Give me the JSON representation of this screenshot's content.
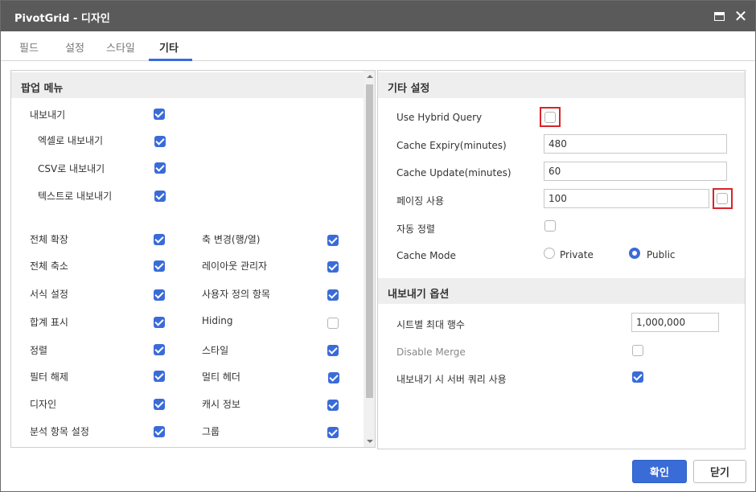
{
  "window": {
    "title": "PivotGrid - 디자인"
  },
  "tabs": [
    {
      "label": "필드"
    },
    {
      "label": "설정"
    },
    {
      "label": "스타일"
    },
    {
      "label": "기타",
      "active": true
    }
  ],
  "popup_menu": {
    "header": "팝업 메뉴",
    "export_items": [
      {
        "label": "내보내기",
        "checked": true
      },
      {
        "label": "엑셀로 내보내기",
        "checked": true
      },
      {
        "label": "CSV로 내보내기",
        "checked": true
      },
      {
        "label": "텍스트로 내보내기",
        "checked": true
      }
    ],
    "left_items": [
      {
        "label": "전체 확장",
        "checked": true
      },
      {
        "label": "전체 축소",
        "checked": true
      },
      {
        "label": "서식 설정",
        "checked": true
      },
      {
        "label": "합계 표시",
        "checked": true
      },
      {
        "label": "정렬",
        "checked": true
      },
      {
        "label": "필터 해제",
        "checked": true
      },
      {
        "label": "디자인",
        "checked": true
      },
      {
        "label": "분석 항목 설정",
        "checked": true
      }
    ],
    "right_items": [
      {
        "label": "축 변경(행/열)",
        "checked": true
      },
      {
        "label": "레이아웃 관리자",
        "checked": true
      },
      {
        "label": "사용자 정의 항목",
        "checked": true
      },
      {
        "label": "Hiding",
        "checked": false
      },
      {
        "label": "스타일",
        "checked": true
      },
      {
        "label": "멀티 헤더",
        "checked": true
      },
      {
        "label": "캐시 정보",
        "checked": true
      },
      {
        "label": "그룹",
        "checked": true
      }
    ]
  },
  "misc_settings": {
    "header": "기타 설정",
    "use_hybrid_query": {
      "label": "Use Hybrid Query",
      "checked": false
    },
    "cache_expiry": {
      "label": "Cache Expiry(minutes)",
      "value": "480"
    },
    "cache_update": {
      "label": "Cache Update(minutes)",
      "value": "60"
    },
    "paging": {
      "label": "페이징 사용",
      "value": "100",
      "checked": false
    },
    "auto_sort": {
      "label": "자동 정렬",
      "checked": false
    },
    "cache_mode": {
      "label": "Cache Mode",
      "options": [
        "Private",
        "Public"
      ],
      "selected": "Public"
    }
  },
  "export_options": {
    "header": "내보내기 옵션",
    "max_rows_per_sheet": {
      "label": "시트별 최대 행수",
      "value": "1,000,000"
    },
    "disable_merge": {
      "label": "Disable Merge",
      "checked": false
    },
    "server_query_on_export": {
      "label": "내보내기 시 서버 쿼리 사용",
      "checked": true
    }
  },
  "footer": {
    "ok_label": "확인",
    "close_label": "닫기"
  },
  "colors": {
    "accent": "#3a6cd8",
    "titlebar": "#5a5a5a",
    "highlight_box": "#d8242a"
  }
}
